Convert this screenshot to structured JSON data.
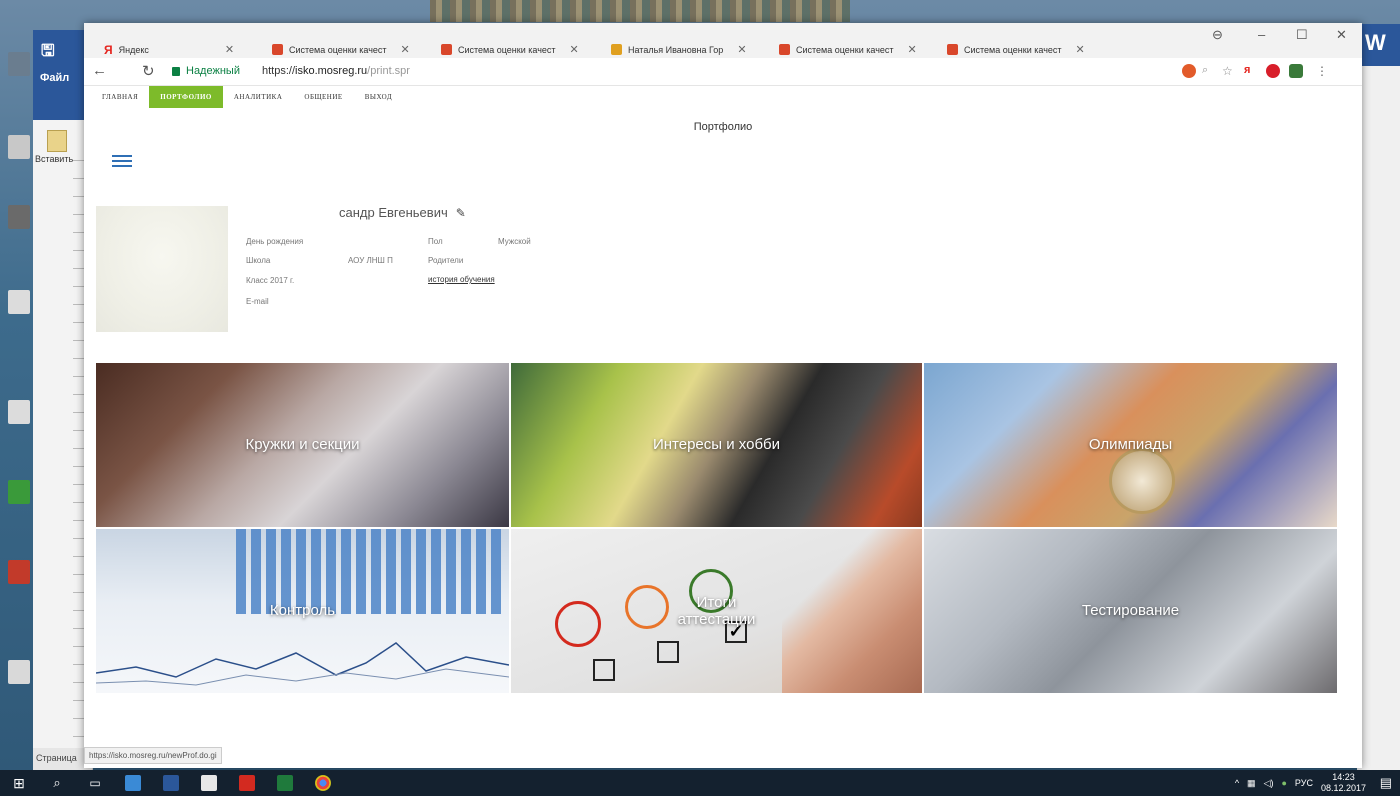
{
  "taskbar": {
    "tray_language": "РУС",
    "clock_time": "14:23",
    "clock_date": "08.12.2017"
  },
  "word_window": {
    "file_tab": "Файл",
    "paste_label": "Вставить",
    "status_text": "Страница"
  },
  "browser": {
    "tabs": [
      {
        "label": "Яндекс"
      },
      {
        "label": "Система оценки качест"
      },
      {
        "label": "Система оценки качест"
      },
      {
        "label": "Наталья Ивановна Гор"
      },
      {
        "label": "Система оценки качест"
      },
      {
        "label": "Система оценки качест"
      }
    ],
    "secure_label": "Надежный",
    "url_scheme": "https://",
    "url_host": "isko.mosreg.ru",
    "url_path": "/print.spr",
    "status_url": "https://isko.mosreg.ru/newProf.do.gi"
  },
  "site": {
    "nav": [
      {
        "label": "ГЛАВНАЯ"
      },
      {
        "label": "ПОРТФОЛИО"
      },
      {
        "label": "АНАЛИТИКА"
      },
      {
        "label": "ОБЩЕНИЕ"
      },
      {
        "label": "ВЫХОД"
      }
    ],
    "page_title": "Портфолио"
  },
  "profile": {
    "name": "сандр Евгеньевич",
    "birthdate_label": "День рождения",
    "school_label": "Школа",
    "school_value": "АОУ ЛНШ П",
    "class_label": "Класс 2017 г.",
    "email_label": "E-mail",
    "gender_label": "Пол",
    "gender_value": "Мужской",
    "parents_label": "Родители",
    "history_link": "история обучения"
  },
  "tiles": [
    {
      "label": "Кружки и секции"
    },
    {
      "label": "Интересы и хобби"
    },
    {
      "label": "Олимпиады"
    },
    {
      "label": "Контроль"
    },
    {
      "label": "Итоги аттестации"
    },
    {
      "label": "Тестирование"
    }
  ],
  "colors": {
    "nav_active": "#7dbb2a",
    "hamburger": "#2f6fb5",
    "secure_green": "#0b8043",
    "taskbar": "#14212f"
  }
}
